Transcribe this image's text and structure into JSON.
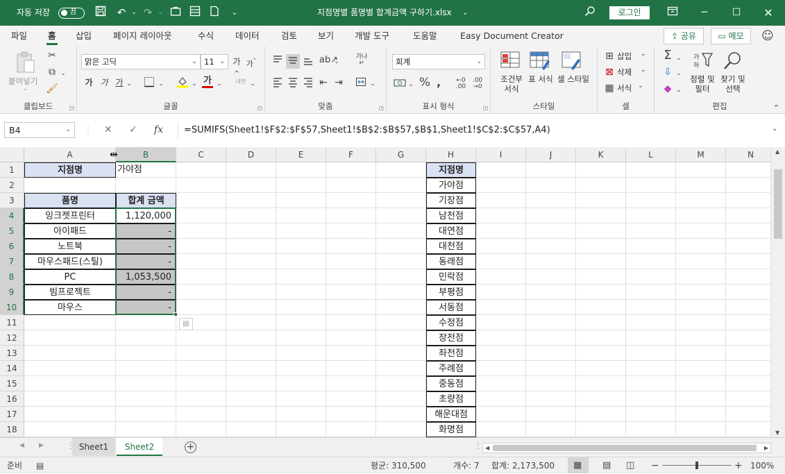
{
  "title": {
    "autosave_label": "자동 저장",
    "autosave_state": "끔",
    "filename": "지점명별 품명별 합계금액 구하기.xlsx",
    "filename_arrow": "⌄",
    "login": "로그인"
  },
  "menu": {
    "items": [
      "파일",
      "홈",
      "삽입",
      "페이지 레이아웃",
      "수식",
      "데이터",
      "검토",
      "보기",
      "개발 도구",
      "도움말",
      "Easy Document Creator"
    ],
    "active": "홈",
    "share": "공유",
    "memo": "메모"
  },
  "ribbon": {
    "clipboard": {
      "paste": "붙여넣기",
      "label": "클립보드"
    },
    "font": {
      "name": "맑은 고딕",
      "size": "11",
      "label": "글꼴",
      "bold": "가",
      "italic": "가",
      "underline": "가",
      "fontcolor": "가"
    },
    "align": {
      "label": "맞춤"
    },
    "number": {
      "format": "회계",
      "label": "표시 형식",
      "percent": "%"
    },
    "style": {
      "cond": "조건부 서식",
      "table": "표 서식",
      "cell": "셀 스타일",
      "label": "스타일"
    },
    "cells": {
      "insert": "삽입",
      "delete": "삭제",
      "format": "서식",
      "label": "셀"
    },
    "edit": {
      "sortfilter": "정렬 및 필터",
      "findselect": "찾기 및 선택",
      "label": "편집"
    }
  },
  "formula_bar": {
    "name_box": "B4",
    "formula": "=SUMIFS(Sheet1!$F$2:$F$57,Sheet1!$B$2:$B$57,$B$1,Sheet1!$C$2:$C$57,A4)"
  },
  "sheet": {
    "columns": [
      "A",
      "B",
      "C",
      "D",
      "E",
      "F",
      "G",
      "H",
      "I",
      "J",
      "K",
      "L",
      "M",
      "N"
    ],
    "rows": [
      "1",
      "2",
      "3",
      "4",
      "5",
      "6",
      "7",
      "8",
      "9",
      "10",
      "11",
      "12",
      "13",
      "14",
      "15",
      "16",
      "17",
      "18"
    ],
    "A1": "지점명",
    "B1": "가야점",
    "A3": "품명",
    "B3": "합계 금액",
    "items": [
      {
        "name": "잉크젯프린터",
        "amount": "1,120,000"
      },
      {
        "name": "아이패드",
        "amount": "-"
      },
      {
        "name": "노트북",
        "amount": "-"
      },
      {
        "name": "마우스패드(스틸)",
        "amount": "-"
      },
      {
        "name": "PC",
        "amount": "1,053,500"
      },
      {
        "name": "빔프로젝트",
        "amount": "-"
      },
      {
        "name": "마우스",
        "amount": "-"
      }
    ],
    "H_header": "지점명",
    "branches": [
      "가야점",
      "기장점",
      "남천점",
      "대연점",
      "대천점",
      "동래점",
      "민락점",
      "부평점",
      "서동점",
      "수정점",
      "장전점",
      "좌천점",
      "주례점",
      "중동점",
      "초량점",
      "해운대점",
      "화명점"
    ]
  },
  "tabs": [
    "Sheet1",
    "Sheet2"
  ],
  "active_tab": "Sheet2",
  "status": {
    "ready": "준비",
    "average": "평균:  310,500",
    "count": "개수: 7",
    "sum": "합계:  2,173,500",
    "zoom": "100%"
  }
}
